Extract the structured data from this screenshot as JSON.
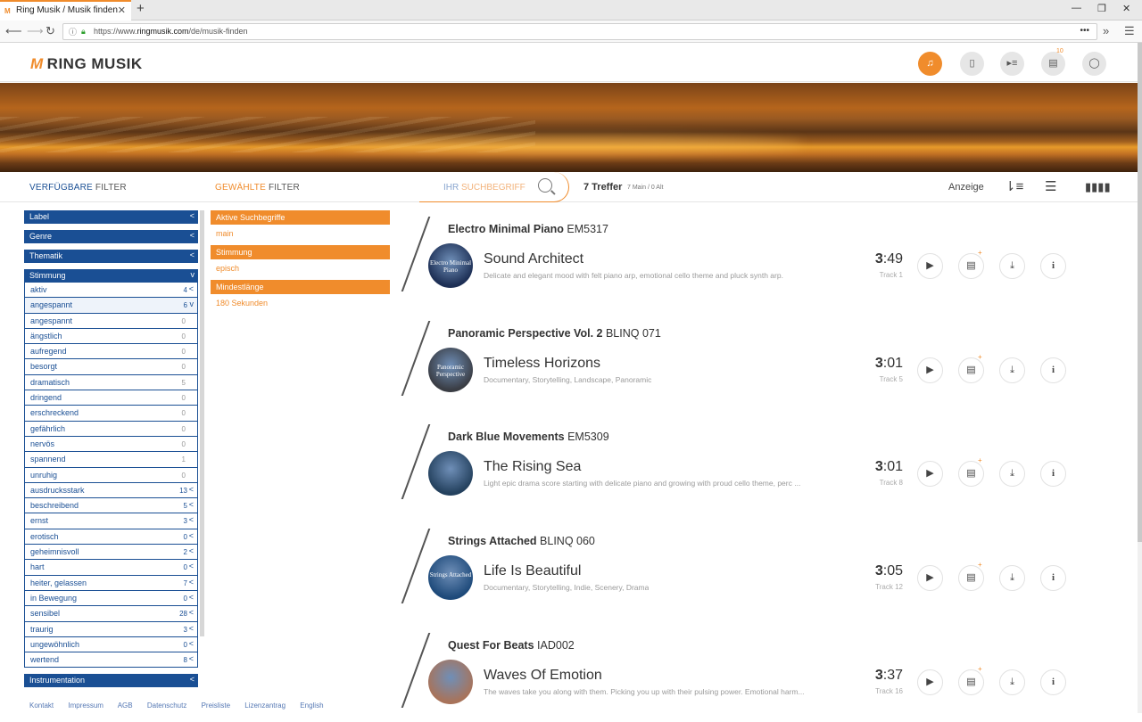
{
  "browser": {
    "tab_title": "Ring Musik / Musik finden",
    "url_prefix": "https://www.",
    "url_domain": "ringmusik.com",
    "url_path": "/de/musik-finden"
  },
  "site": {
    "logo_text": "RING MUSIK",
    "logo_mark": "M",
    "notifications_count": "10"
  },
  "filterbar": {
    "available_bold": "VERFÜGBARE",
    "available_rest": " FILTER",
    "selected_bold": "GEWÄHLTE",
    "selected_rest": " FILTER",
    "search_bold": "IHR",
    "search_rest": " SUCHBEGRIFF",
    "hits": "7 Treffer",
    "hits_sub": "7 Main / 0 Alt",
    "display_label": "Anzeige"
  },
  "left_filters": {
    "label": "Label",
    "genre": "Genre",
    "thematik": "Thematik",
    "stimmung": "Stimmung",
    "instrumentation": "Instrumentation",
    "collapse_glyph": "<",
    "expand_glyph": "v",
    "stimmung_items": [
      {
        "label": "aktiv",
        "count": "4",
        "chevron": "<"
      },
      {
        "label": "angespannt",
        "count": "6",
        "chevron": "v"
      },
      {
        "label": "angespannt",
        "count": "0"
      },
      {
        "label": "ängstlich",
        "count": "0"
      },
      {
        "label": "aufregend",
        "count": "0"
      },
      {
        "label": "besorgt",
        "count": "0"
      },
      {
        "label": "dramatisch",
        "count": "5"
      },
      {
        "label": "dringend",
        "count": "0"
      },
      {
        "label": "erschreckend",
        "count": "0"
      },
      {
        "label": "gefährlich",
        "count": "0"
      },
      {
        "label": "nervös",
        "count": "0"
      },
      {
        "label": "spannend",
        "count": "1"
      },
      {
        "label": "unruhig",
        "count": "0"
      },
      {
        "label": "ausdrucksstark",
        "count": "13",
        "chevron": "<"
      },
      {
        "label": "beschreibend",
        "count": "5",
        "chevron": "<"
      },
      {
        "label": "ernst",
        "count": "3",
        "chevron": "<"
      },
      {
        "label": "erotisch",
        "count": "0",
        "chevron": "<"
      },
      {
        "label": "geheimnisvoll",
        "count": "2",
        "chevron": "<"
      },
      {
        "label": "hart",
        "count": "0",
        "chevron": "<"
      },
      {
        "label": "heiter, gelassen",
        "count": "7",
        "chevron": "<"
      },
      {
        "label": "in Bewegung",
        "count": "0",
        "chevron": "<"
      },
      {
        "label": "sensibel",
        "count": "28",
        "chevron": "<"
      },
      {
        "label": "traurig",
        "count": "3",
        "chevron": "<"
      },
      {
        "label": "ungewöhnlich",
        "count": "0",
        "chevron": "<"
      },
      {
        "label": "wertend",
        "count": "8",
        "chevron": "<"
      }
    ]
  },
  "active_filters": [
    {
      "head": "Aktive Suchbegriffe",
      "value": "main"
    },
    {
      "head": "Stimmung",
      "value": "episch"
    },
    {
      "head": "Mindestlänge",
      "value": "180 Sekunden"
    }
  ],
  "results": [
    {
      "album": "Electro Minimal Piano",
      "code": "EM5317",
      "title": "Sound Architect",
      "desc": "Delicate and elegant mood with felt piano arp, emotional cello theme and pluck synth arp.",
      "dur_min": "3",
      "dur_sec": ":49",
      "track": "Track 1",
      "cover_text": "Electro Minimal Piano",
      "cover_color": "#1d2f55"
    },
    {
      "album": "Panoramic Perspective Vol. 2",
      "code": "BLINQ 071",
      "title": "Timeless Horizons",
      "desc": "Documentary, Storytelling, Landscape, Panoramic",
      "dur_min": "3",
      "dur_sec": ":01",
      "track": "Track 5",
      "cover_text": "Panoramic Perspective",
      "cover_color": "#3a3d44"
    },
    {
      "album": "Dark Blue Movements",
      "code": "EM5309",
      "title": "The Rising Sea",
      "desc": "Light epic drama score starting with delicate piano and growing with proud cello theme, perc ...",
      "dur_min": "3",
      "dur_sec": ":01",
      "track": "Track 8",
      "cover_text": "",
      "cover_color": "#24415e"
    },
    {
      "album": "Strings Attached",
      "code": "BLINQ 060",
      "title": "Life Is Beautiful",
      "desc": "Documentary, Storytelling, Indie, Scenery, Drama",
      "dur_min": "3",
      "dur_sec": ":05",
      "track": "Track 12",
      "cover_text": "Strings Attached",
      "cover_color": "#1e4a7a"
    },
    {
      "album": "Quest For Beats",
      "code": "IAD002",
      "title": "Waves Of Emotion",
      "desc": "The waves take you along with them. Picking you up with their pulsing power. Emotional harm...",
      "dur_min": "3",
      "dur_sec": ":37",
      "track": "Track 16",
      "cover_text": "",
      "cover_color": "#a8735a"
    }
  ],
  "footer": [
    "Kontakt",
    "Impressum",
    "AGB",
    "Datenschutz",
    "Preisliste",
    "Lizenzantrag",
    "English"
  ],
  "colors": {
    "accent": "#f08c2c",
    "brand_blue": "#1a4f94"
  }
}
